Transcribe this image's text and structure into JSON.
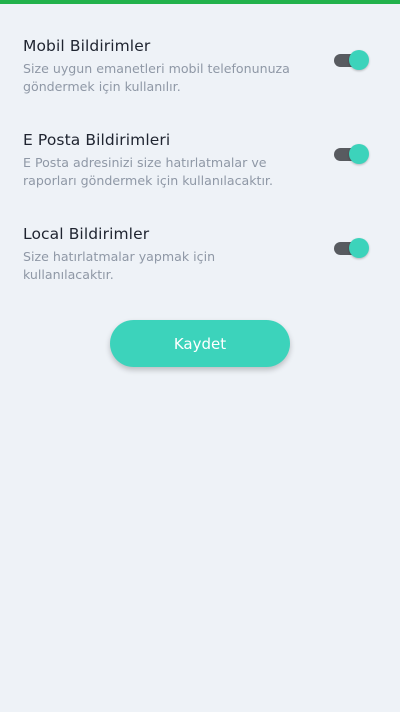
{
  "colors": {
    "accent": "#3cd3bb",
    "top_bar": "#22b24c",
    "track": "#585b60"
  },
  "settings": [
    {
      "title": "Mobil Bildirimler",
      "description": "Size uygun emanetleri mobil telefonunuza göndermek için kullanılır.",
      "enabled": true
    },
    {
      "title": "E Posta Bildirimleri",
      "description": "E Posta adresinizi size hatırlatmalar ve raporları göndermek için kullanılacaktır.",
      "enabled": true
    },
    {
      "title": "Local Bildirimler",
      "description": "Size hatırlatmalar yapmak için kullanılacaktır.",
      "enabled": true
    }
  ],
  "save_label": "Kaydet"
}
